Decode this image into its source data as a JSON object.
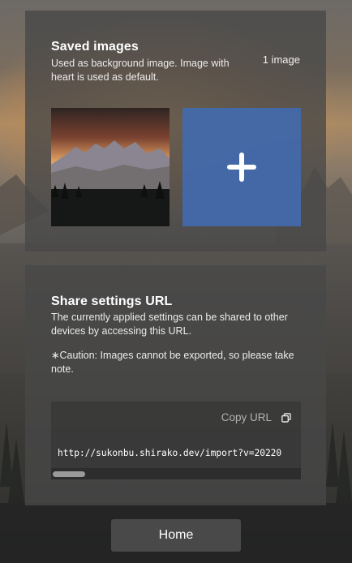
{
  "saved_images": {
    "title": "Saved images",
    "description": "Used as background image. Image with heart is used as default.",
    "count": "1 image",
    "thumbnail_icon": "mountain-sunset-image",
    "add_icon": "plus-icon"
  },
  "share": {
    "title": "Share settings URL",
    "description": "The currently applied settings can be shared to other devices by accessing this URL.",
    "caution": "∗Caution: Images cannot be exported, so please take note.",
    "copy_label": "Copy URL",
    "copy_icon": "copy-icon",
    "url": "http://sukonbu.shirako.dev/import?v=20220"
  },
  "footer": {
    "home_label": "Home"
  },
  "colors": {
    "add_button": "#426aac",
    "panel": "#484848"
  }
}
